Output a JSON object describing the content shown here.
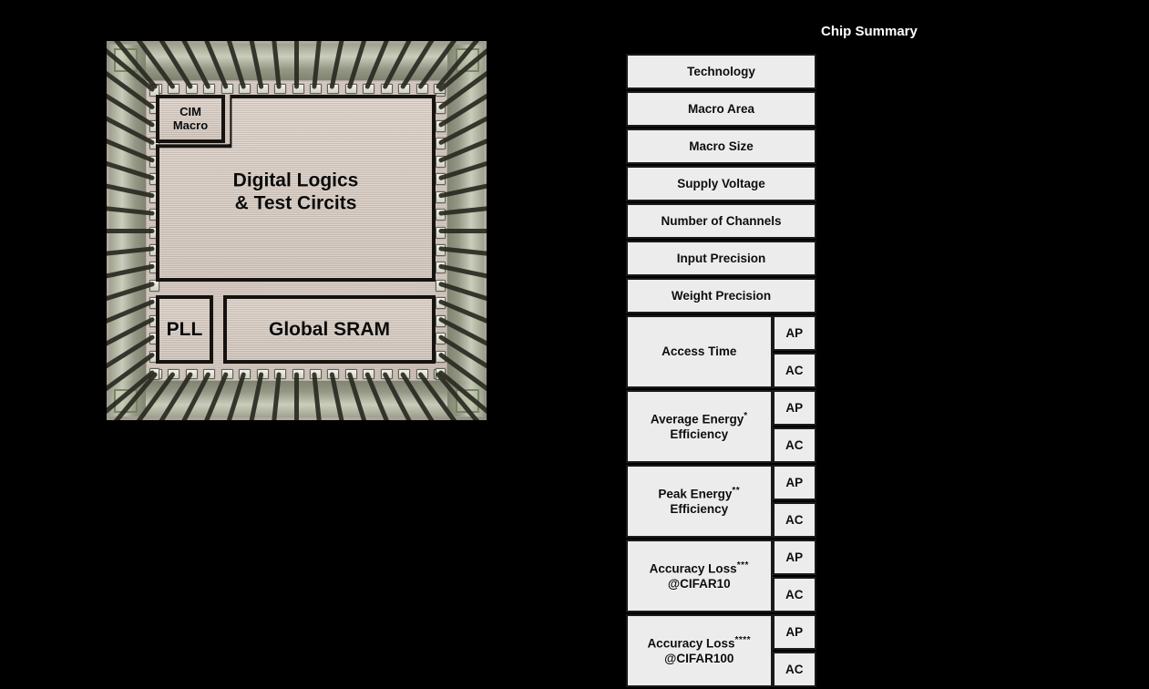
{
  "die_photo": {
    "name": "chip-die-micrograph",
    "blocks": [
      {
        "id": "cim-macro",
        "label": "CIM\nMacro",
        "line1": "CIM",
        "line2": "Macro"
      },
      {
        "id": "digital-logics",
        "label": "Digital Logics\n& Test Circits",
        "line1": "Digital Logics",
        "line2": "& Test Circits"
      },
      {
        "id": "pll",
        "label": "PLL"
      },
      {
        "id": "global-sram",
        "label": "Global SRAM"
      }
    ]
  },
  "summary": {
    "title": "Chip Summary",
    "rows": [
      {
        "label": "Technology",
        "sup": "",
        "label2": "",
        "sub": []
      },
      {
        "label": "Macro Area",
        "sup": "",
        "label2": "",
        "sub": []
      },
      {
        "label": "Macro Size",
        "sup": "",
        "label2": "",
        "sub": []
      },
      {
        "label": "Supply Voltage",
        "sup": "",
        "label2": "",
        "sub": []
      },
      {
        "label": "Number of Channels",
        "sup": "",
        "label2": "",
        "sub": []
      },
      {
        "label": "Input Precision",
        "sup": "",
        "label2": "",
        "sub": []
      },
      {
        "label": "Weight Precision",
        "sup": "",
        "label2": "",
        "sub": []
      },
      {
        "label": "Access Time",
        "sup": "",
        "label2": "",
        "sub": [
          "AP",
          "AC"
        ]
      },
      {
        "label": "Average Energy",
        "sup": "*",
        "label2": "Efficiency",
        "sub": [
          "AP",
          "AC"
        ]
      },
      {
        "label": "Peak Energy",
        "sup": "**",
        "label2": "Efficiency",
        "sub": [
          "AP",
          "AC"
        ]
      },
      {
        "label": "Accuracy Loss",
        "sup": "***",
        "label2": "@CIFAR10",
        "sub": [
          "AP",
          "AC"
        ]
      },
      {
        "label": "Accuracy Loss",
        "sup": "****",
        "label2": "@CIFAR100",
        "sub": [
          "AP",
          "AC"
        ]
      }
    ]
  },
  "colors": {
    "background": "#000000",
    "table_cell_fill": "#ececec",
    "table_border": "#1a1a1a",
    "title_text": "#ffffff",
    "die_surface": "#cfc3b8",
    "block_outline": "#15120f"
  }
}
